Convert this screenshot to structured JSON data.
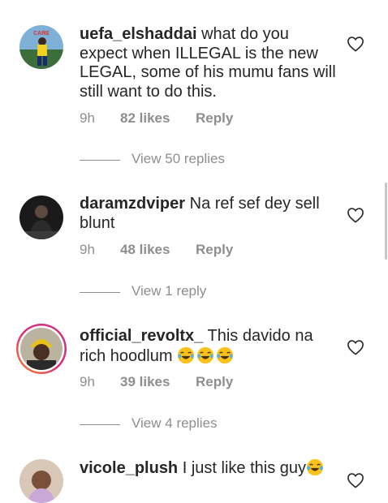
{
  "comments": [
    {
      "username": "uefa_elshaddai",
      "text": " what do you expect when ILLEGAL is the new LEGAL, some of his mumu fans will still want to do this.",
      "time": "9h",
      "likes": "82 likes",
      "reply_label": "Reply",
      "view_replies": "View 50 replies"
    },
    {
      "username": "daramzdviper",
      "text": " Na ref sef dey sell blunt",
      "time": "9h",
      "likes": "48 likes",
      "reply_label": "Reply",
      "view_replies": "View 1 reply"
    },
    {
      "username": "official_revoltx_",
      "text": " This davido na rich hoodlum ",
      "time": "9h",
      "likes": "39 likes",
      "reply_label": "Reply",
      "view_replies": "View 4 replies"
    },
    {
      "username": "vicole_plush",
      "text": " I just like this guy"
    }
  ],
  "colors": {
    "text": "#262626",
    "muted": "#8e8e8e",
    "story_ring_start": "#f58529",
    "story_ring_end": "#dd2a7b"
  },
  "icons": {
    "like": "heart-outline-icon",
    "emoji": "face-with-tears-of-joy"
  }
}
